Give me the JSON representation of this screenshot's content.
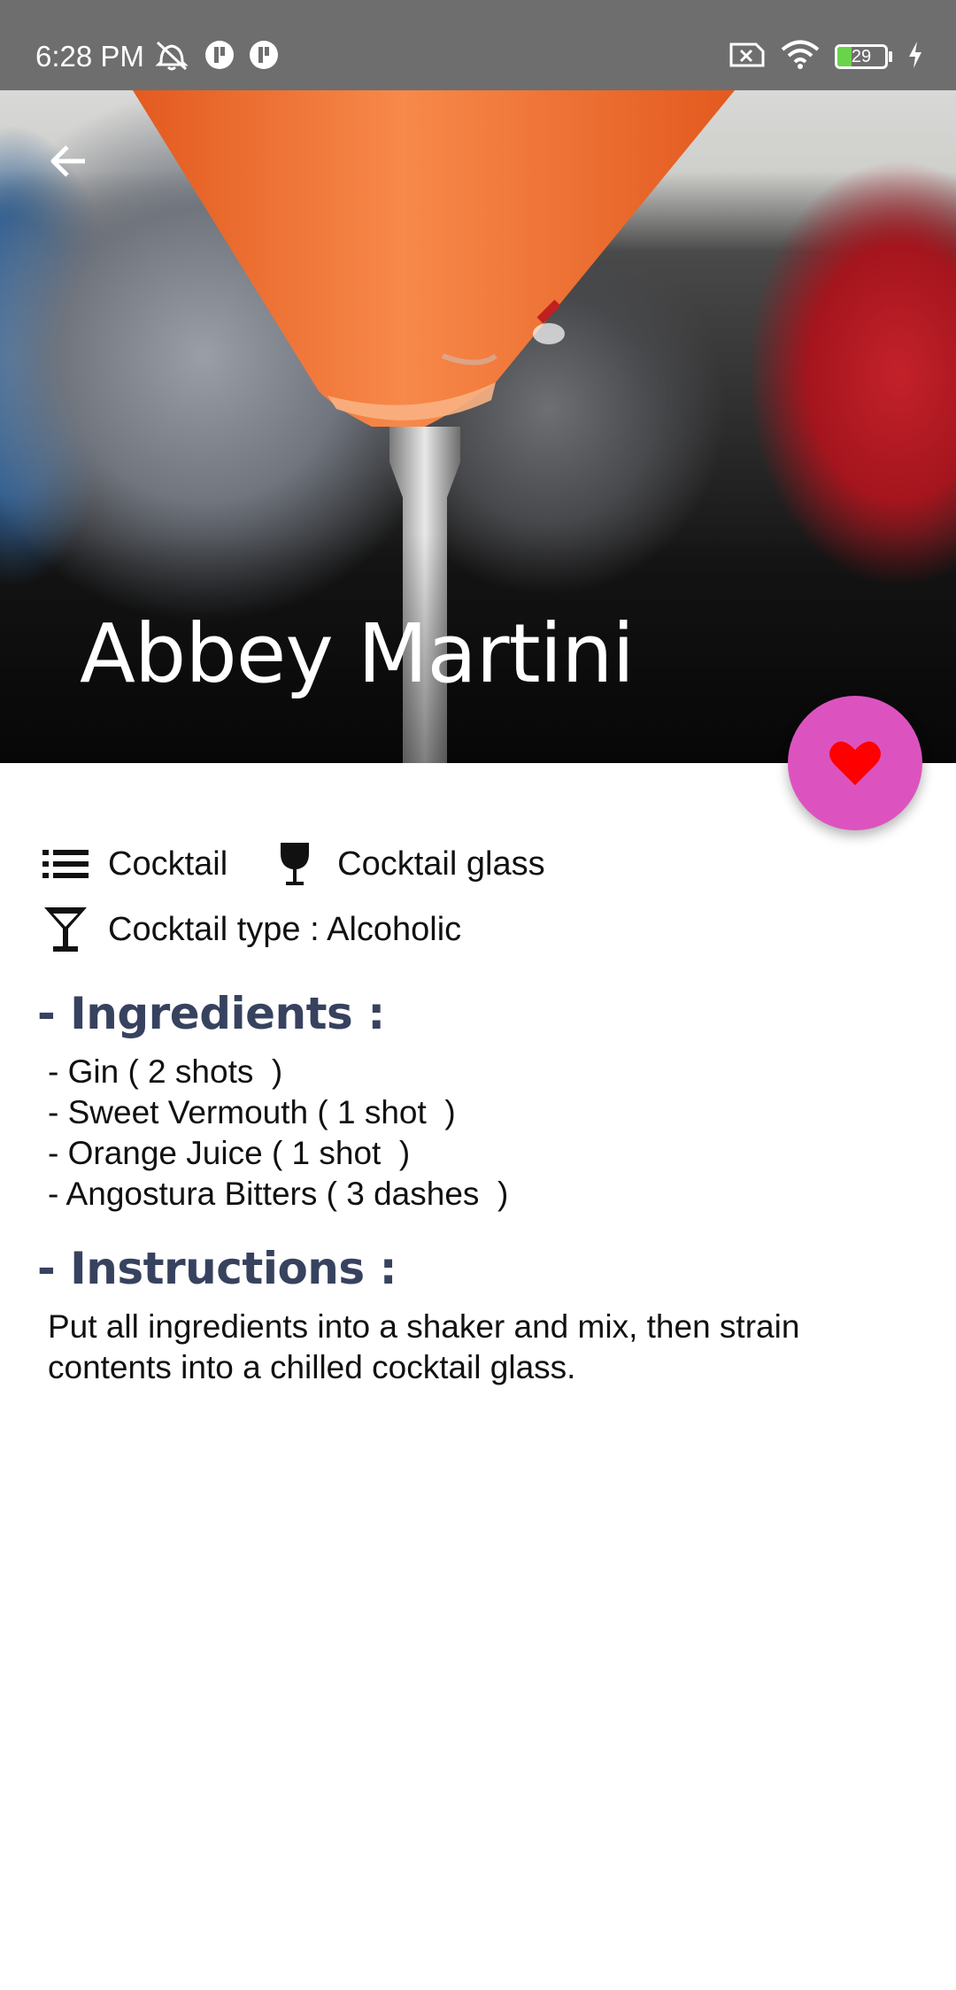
{
  "status_bar": {
    "time": "6:28 PM",
    "battery_level": "29",
    "battery_fraction": 0.29,
    "icons_left": [
      "alarm-off-icon",
      "notification-app-icon",
      "notification-app-icon"
    ],
    "icons_right": [
      "no-sim-icon",
      "wifi-icon",
      "battery-icon",
      "charging-icon"
    ]
  },
  "header": {
    "back_icon": "arrow-back-icon",
    "title": "Abbey Martini"
  },
  "favorite": {
    "icon": "heart-icon",
    "color": "#dc53c0",
    "heart_color": "#ff0000"
  },
  "meta": {
    "category": "Cocktail",
    "glass": "Cocktail glass",
    "type": "Cocktail type : Alcoholic"
  },
  "ingredients": {
    "heading": "- Ingredients :",
    "items": [
      "- Gin ( 2 shots  )",
      "- Sweet Vermouth ( 1 shot  )",
      "- Orange Juice ( 1 shot  )",
      "- Angostura Bitters ( 3 dashes  )"
    ]
  },
  "instructions": {
    "heading": "- Instructions :",
    "text": "Put all ingredients into a shaker and mix, then strain contents into a chilled cocktail glass."
  }
}
